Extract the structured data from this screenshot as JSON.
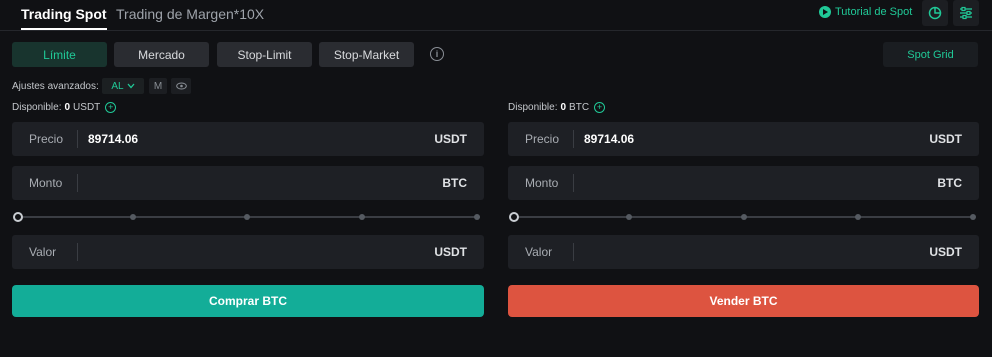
{
  "tabs": {
    "spot": "Trading Spot",
    "margin": "Trading de Margen*10X"
  },
  "header": {
    "tutorial": "Tutorial de Spot",
    "pie_icon": "pie-chart-icon",
    "settings_icon": "sliders-icon"
  },
  "order_types": [
    {
      "label": "Límite",
      "active": true
    },
    {
      "label": "Mercado",
      "active": false
    },
    {
      "label": "Stop-Limit",
      "active": false
    },
    {
      "label": "Stop-Market",
      "active": false
    }
  ],
  "spot_grid": "Spot Grid",
  "advanced": {
    "label": "Ajustes avanzados:",
    "al": "AL",
    "m": "M",
    "eye_icon": "eye-icon"
  },
  "buy": {
    "available_label": "Disponible:",
    "available_value": "0",
    "available_unit": "USDT",
    "price_label": "Precio",
    "price_value": "89714.06",
    "price_unit": "USDT",
    "amount_label": "Monto",
    "amount_value": "",
    "amount_unit": "BTC",
    "value_label": "Valor",
    "value_value": "",
    "value_unit": "USDT",
    "button": "Comprar BTC"
  },
  "sell": {
    "available_label": "Disponible:",
    "available_value": "0",
    "available_unit": "BTC",
    "price_label": "Precio",
    "price_value": "89714.06",
    "price_unit": "USDT",
    "amount_label": "Monto",
    "amount_value": "",
    "amount_unit": "BTC",
    "value_label": "Valor",
    "value_value": "",
    "value_unit": "USDT",
    "button": "Vender BTC"
  },
  "colors": {
    "accent": "#20c997",
    "buy": "#13ad98",
    "sell": "#dd5440",
    "background": "#101114"
  }
}
